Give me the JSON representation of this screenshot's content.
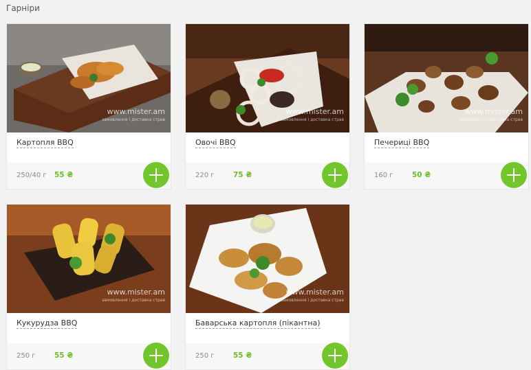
{
  "section": {
    "title": "Гарніри"
  },
  "watermark": {
    "site": "www.mister.am",
    "tagline": "замовлення і доставка страв"
  },
  "products": [
    {
      "name": "Картопля BBQ",
      "weight": "250/40 г",
      "price": "55 ₴",
      "photo_icon": "potato-wedges-image"
    },
    {
      "name": "Овочі BBQ",
      "weight": "220 г",
      "price": "75 ₴",
      "photo_icon": "grilled-vegetables-image"
    },
    {
      "name": "Печериці BBQ",
      "weight": "160 г",
      "price": "50 ₴",
      "photo_icon": "grilled-mushrooms-image"
    },
    {
      "name": "Кукурудза BBQ",
      "weight": "250 г",
      "price": "55 ₴",
      "photo_icon": "grilled-corn-image"
    },
    {
      "name": "Баварська картопля (пікантна)",
      "weight": "250 г",
      "price": "55 ₴",
      "photo_icon": "bavarian-potatoes-image"
    }
  ],
  "colors": {
    "accent": "#72c52a",
    "price": "#6cbc22",
    "page_bg": "#f2f2f2"
  }
}
